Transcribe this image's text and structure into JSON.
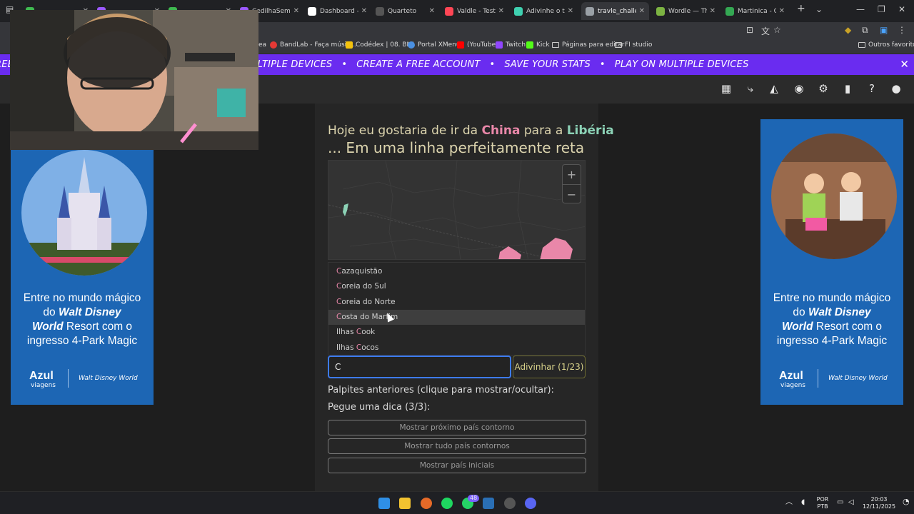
{
  "browser": {
    "tabs": [
      {
        "label": "",
        "color": "#3fb950"
      },
      {
        "label": "",
        "color": "#9b59ff"
      },
      {
        "label": "",
        "color": "#3fb950"
      },
      {
        "label": "CedilhaSem(",
        "color": "#9b59ff"
      },
      {
        "label": "Dashboard - Live",
        "color": "#ffffff"
      },
      {
        "label": "Quarteto",
        "color": "#555555"
      },
      {
        "label": "Valdle - Test Your",
        "color": "#ff4655"
      },
      {
        "label": "Adivinhe o taman",
        "color": "#3fd0b0"
      },
      {
        "label": "travle_challenge",
        "color": "#9aa0a6"
      },
      {
        "label": "Wordle — The N",
        "color": "#7cb342"
      },
      {
        "label": "Martinica - Goog",
        "color": "#34a853"
      }
    ],
    "active_tab_index": 8
  },
  "bookmarks": [
    {
      "label": "ea"
    },
    {
      "label": "BandLab - Faça músic..."
    },
    {
      "label": "Codédex | 08. BMI"
    },
    {
      "label": "Portal XMenu"
    },
    {
      "label": "(YouTube"
    },
    {
      "label": "Twitch"
    },
    {
      "label": "Kick"
    },
    {
      "label": "Páginas para editar"
    },
    {
      "label": "FI studio"
    },
    {
      "label": "Outros favoritos"
    }
  ],
  "promo": {
    "items": [
      "CREATE A FREE ACCOUNT",
      "SAVE YOUR STATS",
      "PLAY ON MULTIPLE DEVICES"
    ],
    "close": "✕"
  },
  "game": {
    "prompt_prefix": "Hoje eu gostaria de ir da",
    "from_country": "China",
    "prompt_mid": "para a",
    "to_country": "Libéria",
    "prompt_line2": "... Em uma linha perfeitamente reta",
    "zoom_in": "+",
    "zoom_out": "−",
    "suggestions": [
      {
        "first": "C",
        "rest": "azaquistão",
        "pre": ""
      },
      {
        "first": "C",
        "rest": "oreia do Sul",
        "pre": ""
      },
      {
        "first": "C",
        "rest": "oreia do Norte",
        "pre": ""
      },
      {
        "first": "C",
        "rest": "osta do Marfim",
        "pre": ""
      },
      {
        "first": "C",
        "rest": "ook",
        "pre": "Ilhas "
      },
      {
        "first": "C",
        "rest": "ocos",
        "pre": "Ilhas "
      }
    ],
    "highlighted_suggestion": 3,
    "input_value": "C",
    "guess_button": "Adivinhar (1/23)",
    "previous_guesses_label": "Palpites anteriores (clique para mostrar/ocultar):",
    "hint_label": "Pegue uma dica (3/3):",
    "hint_buttons": [
      "Mostrar próximo país contorno",
      "Mostrar tudo país contornos",
      "Mostrar país iniciais"
    ]
  },
  "ads": {
    "text_line1": "Entre no mundo mágico",
    "text_line2_pre": "do ",
    "text_line2_bold": "Walt Disney",
    "text_line3_bold": "World",
    "text_line3_rest": " Resort com o",
    "text_line4": "ingresso 4-Park Magic",
    "brand": "Azul",
    "brand_sub": "viagens",
    "partner": "Walt Disney World"
  },
  "taskbar": {
    "lang": "POR",
    "layout": "PTB",
    "time": "20:03",
    "date": "12/11/2025",
    "badge_count": "48"
  },
  "colors": {
    "accent": "#6a2cf0",
    "from_country": "#e987a9",
    "to_country": "#8cd2b6",
    "prompt": "#dcd4ae",
    "input_border": "#3d7bf0",
    "guess_button_border": "#6d6b2f"
  }
}
